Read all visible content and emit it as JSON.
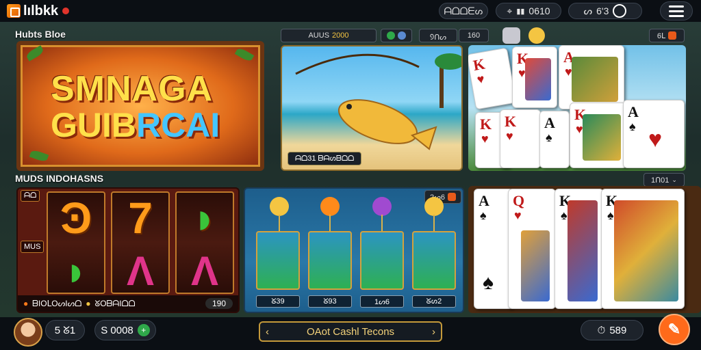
{
  "topbar": {
    "logo_text": "lılbkk",
    "pill1": "ᗩᗝᗝᗴᔕ",
    "pill2_value": "0610",
    "pill3_value": "6'3",
    "icons": [
      "location-pin-icon",
      "bar-chart-icon",
      "controller-icon",
      "clock-icon",
      "hamburger-menu-icon"
    ]
  },
  "sections": {
    "top_label": "Hubts Bloe",
    "bottom_label": "MUDS INDOHASNS",
    "chip_auus": "AUUS",
    "chip_auus_value": "2000",
    "chip_aus2": "᠑ᑎᔕ",
    "chip_qr": "160",
    "chip_right_top": "6ᒪ",
    "chip_right_mid": "1ᑎ01",
    "chip_mid_tile": "2ᔕ6"
  },
  "banner": {
    "line1": "SMNAGA",
    "line2_a": "GUIB",
    "line2_b": "RCAI"
  },
  "fish_tile": {
    "tag": "ᗩᗝ31 ᗷᗩᔕᗷᗝᗝ"
  },
  "reels_tile": {
    "side_label": "MUS",
    "top_label": "ᗩᗝ",
    "bottom_left": "ᗷIOᒪOᔕIᔕᗝ",
    "bottom_mid": "ᘜOᗷᗩIᗝᗝ",
    "bottom_right": "190"
  },
  "fishgame_tile": {
    "labels": [
      "ᘜ39",
      "ᘜ93",
      "1ᔕ6",
      "ᘜᔕ2"
    ]
  },
  "bottombar": {
    "balance1": "5 ᘜ1",
    "balance2": "S 0008",
    "center_text": "OAot Cashl Tecons",
    "right_value": "589"
  },
  "colors": {
    "accent_orange": "#ff6a1a",
    "gold": "#c59a3a",
    "green": "#2fa84a"
  }
}
